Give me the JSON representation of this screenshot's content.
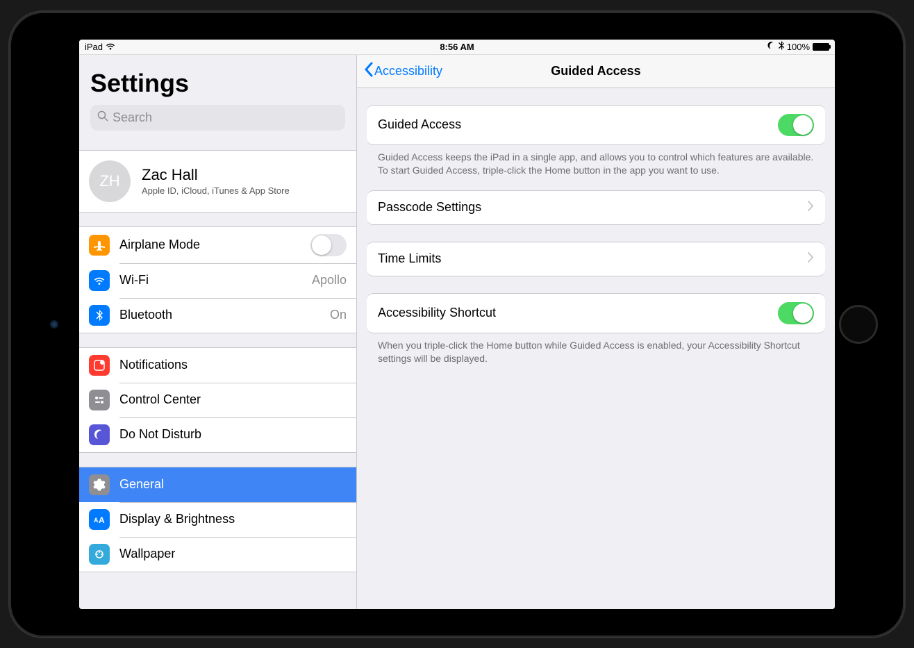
{
  "status": {
    "device": "iPad",
    "time": "8:56 AM",
    "battery": "100%"
  },
  "sidebar": {
    "title": "Settings",
    "search_placeholder": "Search",
    "profile": {
      "initials": "ZH",
      "name": "Zac Hall",
      "sub": "Apple ID, iCloud, iTunes & App Store"
    },
    "airplane": "Airplane Mode",
    "wifi": "Wi-Fi",
    "wifi_value": "Apollo",
    "bluetooth": "Bluetooth",
    "bluetooth_value": "On",
    "notifications": "Notifications",
    "control_center": "Control Center",
    "dnd": "Do Not Disturb",
    "general": "General",
    "display": "Display & Brightness",
    "wallpaper": "Wallpaper"
  },
  "nav": {
    "back": "Accessibility",
    "title": "Guided Access"
  },
  "detail": {
    "guided_access": "Guided Access",
    "guided_footer": "Guided Access keeps the iPad in a single app, and allows you to control which features are available. To start Guided Access, triple-click the Home button in the app you want to use.",
    "passcode": "Passcode Settings",
    "time_limits": "Time Limits",
    "shortcut": "Accessibility Shortcut",
    "shortcut_footer": "When you triple-click the Home button while Guided Access is enabled, your Accessibility Shortcut settings will be displayed."
  }
}
